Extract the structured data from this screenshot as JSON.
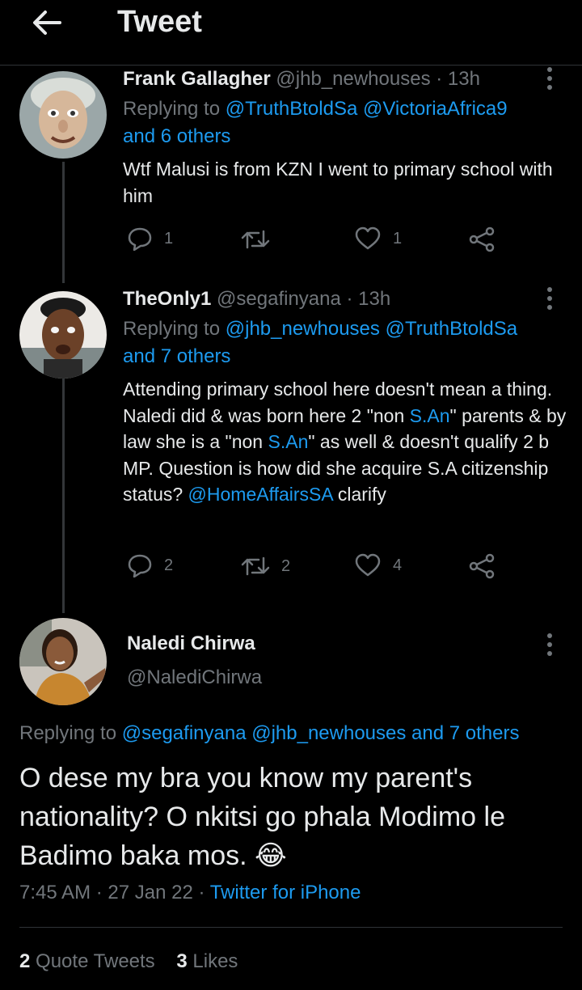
{
  "header": {
    "title": "Tweet"
  },
  "replies": [
    {
      "name": "Frank Gallagher",
      "handle": "@jhb_newhouses",
      "time": "· 13h",
      "replying_prefix": "Replying to",
      "replying_mentions": "@TruthBtoldSa @VictoriaAfrica9",
      "replying_others": "and 6 others",
      "text": "Wtf Malusi is from KZN I went to primary school with him",
      "reply_count": "1",
      "retweet_count": "",
      "like_count": "1"
    },
    {
      "name": "TheOnly1",
      "handle": "@segafinyana",
      "time": "· 13h",
      "replying_prefix": "Replying to",
      "replying_mentions": "@jhb_newhouses @TruthBtoldSa",
      "replying_others": "and 7 others",
      "text_parts": {
        "p1": "Attending primary school here doesn't mean a thing. Naledi did & was born here 2 \"non ",
        "l1": "S.An",
        "p2": "\" parents & by law she is a \"non ",
        "l2": "S.An",
        "p3": "\" as well & doesn't qualify 2 b MP. Question is how did she acquire S.A citizenship status? ",
        "l3": "@HomeAffairsSA",
        "p4": " clarify"
      },
      "reply_count": "2",
      "retweet_count": "2",
      "like_count": "4"
    }
  ],
  "main": {
    "name": "Naledi Chirwa",
    "handle": "@NalediChirwa",
    "replying_prefix": "Replying to",
    "replying_mentions": "@segafinyana @jhb_newhouses and 7 others",
    "text": "O dese my bra you know my parent's nationality? O nkitsi go phala Modimo le Badimo baka mos. 😂",
    "time": "7:45 AM",
    "date": "· 27 Jan 22 ·",
    "source": "Twitter for iPhone",
    "quote_count": "2",
    "quote_label": "Quote Tweets",
    "like_count": "3",
    "like_label": "Likes"
  },
  "colors": {
    "accent": "#1d9bf0",
    "muted": "#71767b",
    "text": "#e7e9ea",
    "bg": "#000000"
  }
}
